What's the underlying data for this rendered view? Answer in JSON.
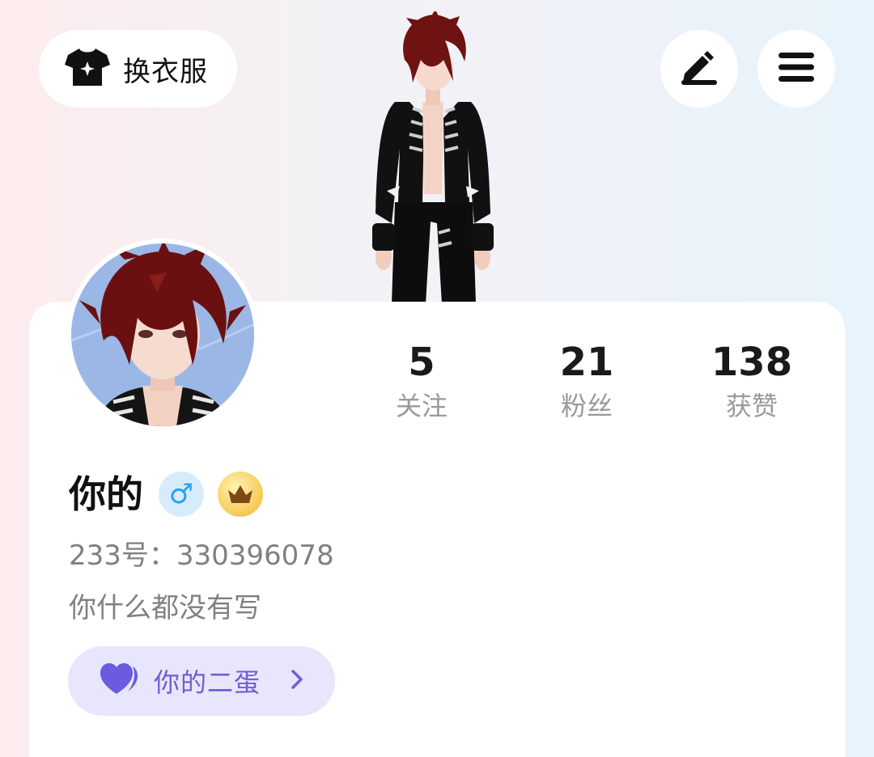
{
  "header": {
    "outfit_label": "换衣服",
    "outfit_icon": "shirt-icon",
    "edit_icon": "edit-pen-icon",
    "menu_icon": "hamburger-menu-icon"
  },
  "profile": {
    "username": "你的",
    "gender_symbol": "♂",
    "vip_icon": "crown-icon",
    "account_id": "233号：330396078",
    "bio": "你什么都没有写"
  },
  "stats": [
    {
      "value": "5",
      "label": "关注"
    },
    {
      "value": "21",
      "label": "粉丝"
    },
    {
      "value": "138",
      "label": "获赞"
    }
  ],
  "egg_link": {
    "label": "你的二蛋",
    "icon": "purple-heart-icon",
    "chevron": "chevron-right-icon"
  },
  "colors": {
    "accent_purple": "#6d5fd6",
    "pill_bg": "#e8e6fc",
    "male_blue": "#2aa1ef",
    "gold": "#f2c24f",
    "hair_red": "#7a1414"
  }
}
